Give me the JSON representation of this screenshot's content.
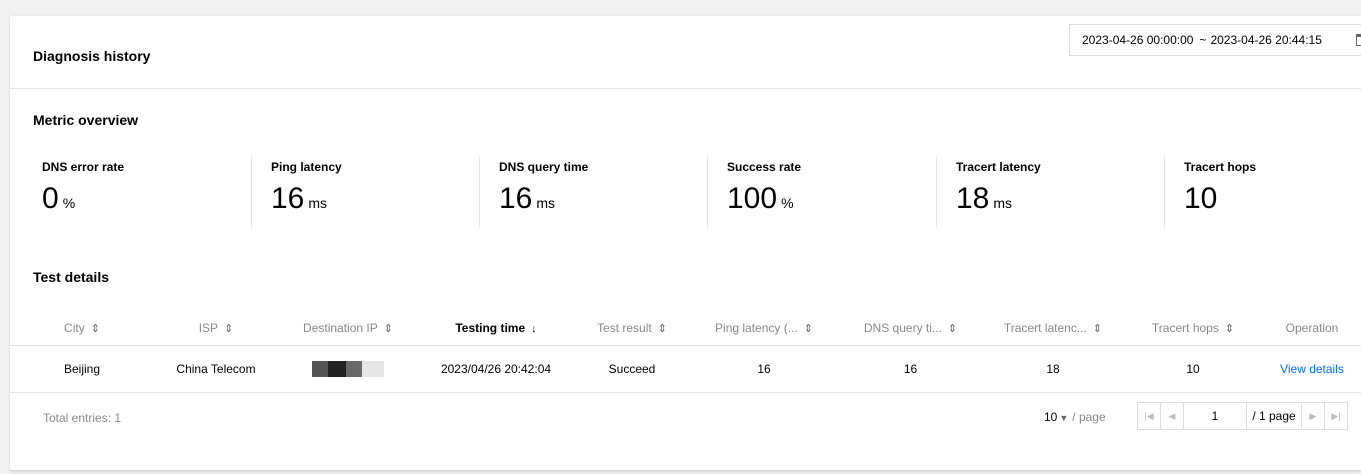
{
  "header": {
    "title": "Diagnosis history",
    "date_start": "2023-04-26 00:00:00",
    "date_separator": "~",
    "date_end": "2023-04-26 20:44:15",
    "calendar_icon": "calendar-icon"
  },
  "metrics": {
    "title": "Metric overview",
    "items": [
      {
        "label": "DNS error rate",
        "value": "0",
        "unit": "%"
      },
      {
        "label": "Ping latency",
        "value": "16",
        "unit": "ms"
      },
      {
        "label": "DNS query time",
        "value": "16",
        "unit": "ms"
      },
      {
        "label": "Success rate",
        "value": "100",
        "unit": "%"
      },
      {
        "label": "Tracert latency",
        "value": "18",
        "unit": "ms"
      },
      {
        "label": "Tracert hops",
        "value": "10",
        "unit": ""
      }
    ]
  },
  "table": {
    "title": "Test details",
    "columns": [
      {
        "label": "City",
        "sort_icon": "⇕"
      },
      {
        "label": "ISP",
        "sort_icon": "⇕"
      },
      {
        "label": "Destination IP",
        "sort_icon": "⇕"
      },
      {
        "label": "Testing time",
        "sort_icon": "↓"
      },
      {
        "label": "Test result",
        "sort_icon": "⇕"
      },
      {
        "label": "Ping latency (...",
        "sort_icon": "⇕"
      },
      {
        "label": "DNS query ti...",
        "sort_icon": "⇕"
      },
      {
        "label": "Tracert latenc...",
        "sort_icon": "⇕"
      },
      {
        "label": "Tracert hops",
        "sort_icon": "⇕"
      },
      {
        "label": "Operation",
        "sort_icon": ""
      }
    ],
    "rows": [
      {
        "city": "Beijing",
        "isp": "China Telecom",
        "ip_masked": "redacted",
        "testing_time": "2023/04/26 20:42:04",
        "result": "Succeed",
        "ping": "16",
        "dns": "16",
        "tracert_latency": "18",
        "tracert_hops": "10",
        "operation": "View details"
      }
    ]
  },
  "footer": {
    "total": "Total entries: 1",
    "page_size": "10",
    "per_page": "/ page",
    "current_page": "1",
    "total_pages": "/ 1 page"
  },
  "colors": {
    "link": "#006eff",
    "muted": "#888888",
    "border": "#e5e5e5"
  }
}
